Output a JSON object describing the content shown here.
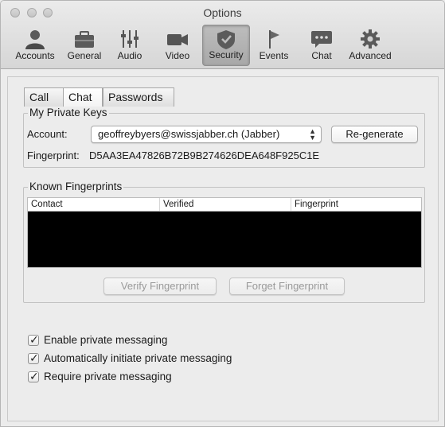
{
  "window": {
    "title": "Options"
  },
  "toolbar": {
    "items": [
      {
        "label": "Accounts",
        "icon": "accounts-icon"
      },
      {
        "label": "General",
        "icon": "general-icon"
      },
      {
        "label": "Audio",
        "icon": "audio-icon"
      },
      {
        "label": "Video",
        "icon": "video-icon"
      },
      {
        "label": "Security",
        "icon": "security-icon",
        "active": true
      },
      {
        "label": "Events",
        "icon": "events-icon"
      },
      {
        "label": "Chat",
        "icon": "chat-icon"
      },
      {
        "label": "Advanced",
        "icon": "advanced-icon"
      }
    ]
  },
  "tabs": [
    {
      "label": "Call"
    },
    {
      "label": "Chat",
      "active": true
    },
    {
      "label": "Passwords"
    }
  ],
  "private_keys": {
    "title": "My Private Keys",
    "account_label": "Account:",
    "account_value": "geoffreybyers@swissjabber.ch (Jabber)",
    "regenerate_label": "Re-generate",
    "fingerprint_label": "Fingerprint:",
    "fingerprint_value": "D5AA3EA47826B72B9B274626DEA648F925C1E"
  },
  "known_fingerprints": {
    "title": "Known Fingerprints",
    "columns": [
      "Contact",
      "Verified",
      "Fingerprint"
    ],
    "rows": [],
    "verify_label": "Verify Fingerprint",
    "forget_label": "Forget Fingerprint"
  },
  "options": [
    {
      "label": "Enable private messaging",
      "checked": true
    },
    {
      "label": "Automatically initiate private messaging",
      "checked": true
    },
    {
      "label": "Require private messaging",
      "checked": true
    }
  ]
}
